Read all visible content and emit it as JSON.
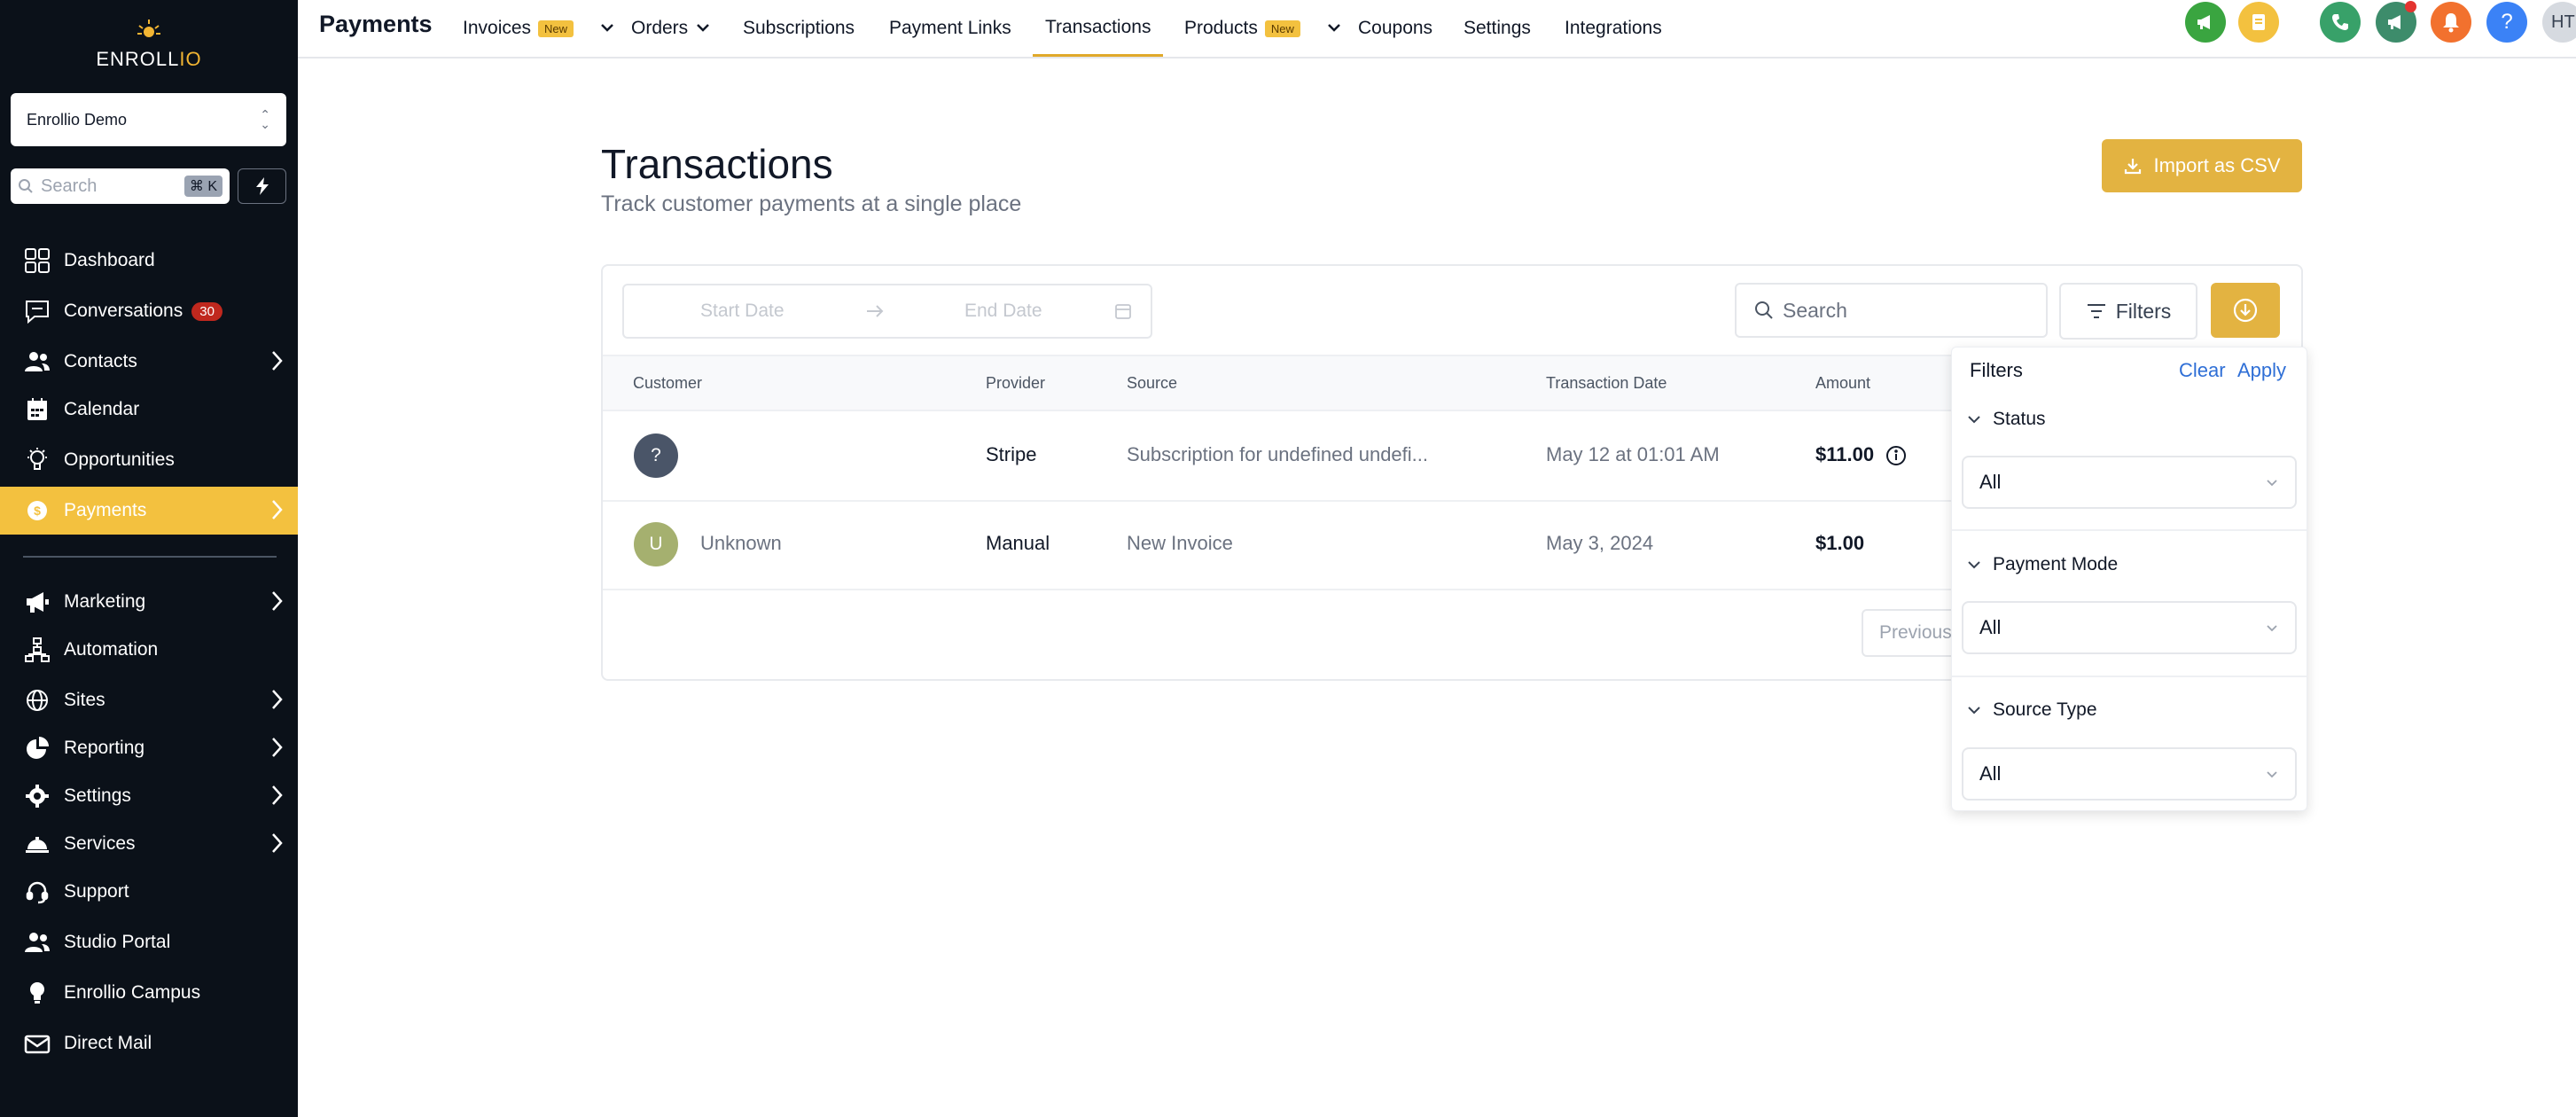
{
  "sidebar": {
    "logo_text_main": "ENROLL",
    "logo_text_accent": "IO",
    "account_name": "Enrollio Demo",
    "search_placeholder": "Search",
    "search_shortcut": "⌘ K",
    "items": [
      {
        "label": "Dashboard",
        "icon": "grid-icon"
      },
      {
        "label": "Conversations",
        "icon": "chat-icon",
        "badge": "30"
      },
      {
        "label": "Contacts",
        "icon": "users-icon"
      },
      {
        "label": "Calendar",
        "icon": "calendar-icon"
      },
      {
        "label": "Opportunities",
        "icon": "funnel-icon"
      },
      {
        "label": "Payments",
        "icon": "payments-icon"
      },
      {
        "label": "Marketing",
        "icon": "megaphone-icon"
      },
      {
        "label": "Automation",
        "icon": "workflow-icon"
      },
      {
        "label": "Sites",
        "icon": "globe-icon"
      },
      {
        "label": "Reporting",
        "icon": "pie-chart-icon"
      },
      {
        "label": "Settings",
        "icon": "gear-icon"
      },
      {
        "label": "Services",
        "icon": "bell-service-icon"
      },
      {
        "label": "Support",
        "icon": "headset-icon"
      },
      {
        "label": "Studio Portal",
        "icon": "users-icon"
      },
      {
        "label": "Enrollio Campus",
        "icon": "lightbulb-icon"
      },
      {
        "label": "Direct Mail",
        "icon": "mail-icon"
      }
    ]
  },
  "topbar": {
    "title": "Payments",
    "tabs": {
      "invoices": "Invoices",
      "orders": "Orders",
      "subscriptions": "Subscriptions",
      "payment_links": "Payment Links",
      "transactions": "Transactions",
      "products": "Products",
      "coupons": "Coupons",
      "settings": "Settings",
      "integrations": "Integrations"
    },
    "new_badge": "New",
    "user_initials": "HT"
  },
  "page": {
    "title": "Transactions",
    "subtitle": "Track customer payments at a single place",
    "import_button": "Import as CSV"
  },
  "toolbar": {
    "start_date_placeholder": "Start Date",
    "end_date_placeholder": "End Date",
    "search_placeholder": "Search",
    "filters_button": "Filters"
  },
  "table": {
    "columns": [
      "Customer",
      "Provider",
      "Source",
      "Transaction Date",
      "Amount"
    ],
    "rows": [
      {
        "avatar": "?",
        "customer": "",
        "provider": "Stripe",
        "source": "Subscription for undefined undefi...",
        "date": "May 12 at 01:01 AM",
        "amount": "$11.00"
      },
      {
        "avatar": "U",
        "customer": "Unknown",
        "provider": "Manual",
        "source": "New Invoice",
        "date": "May 3, 2024",
        "amount": "$1.00"
      }
    ],
    "previous_button": "Previous"
  },
  "filters_panel": {
    "title": "Filters",
    "clear": "Clear",
    "apply": "Apply",
    "status_label": "Status",
    "status_value": "All",
    "payment_mode_label": "Payment Mode",
    "payment_mode_value": "All",
    "source_type_label": "Source Type",
    "source_type_value": "All"
  },
  "colors": {
    "sidebar_bg": "#0b1119",
    "accent": "#f3c13f",
    "button_gold": "#e3b341",
    "link_blue": "#2f6fd6"
  }
}
